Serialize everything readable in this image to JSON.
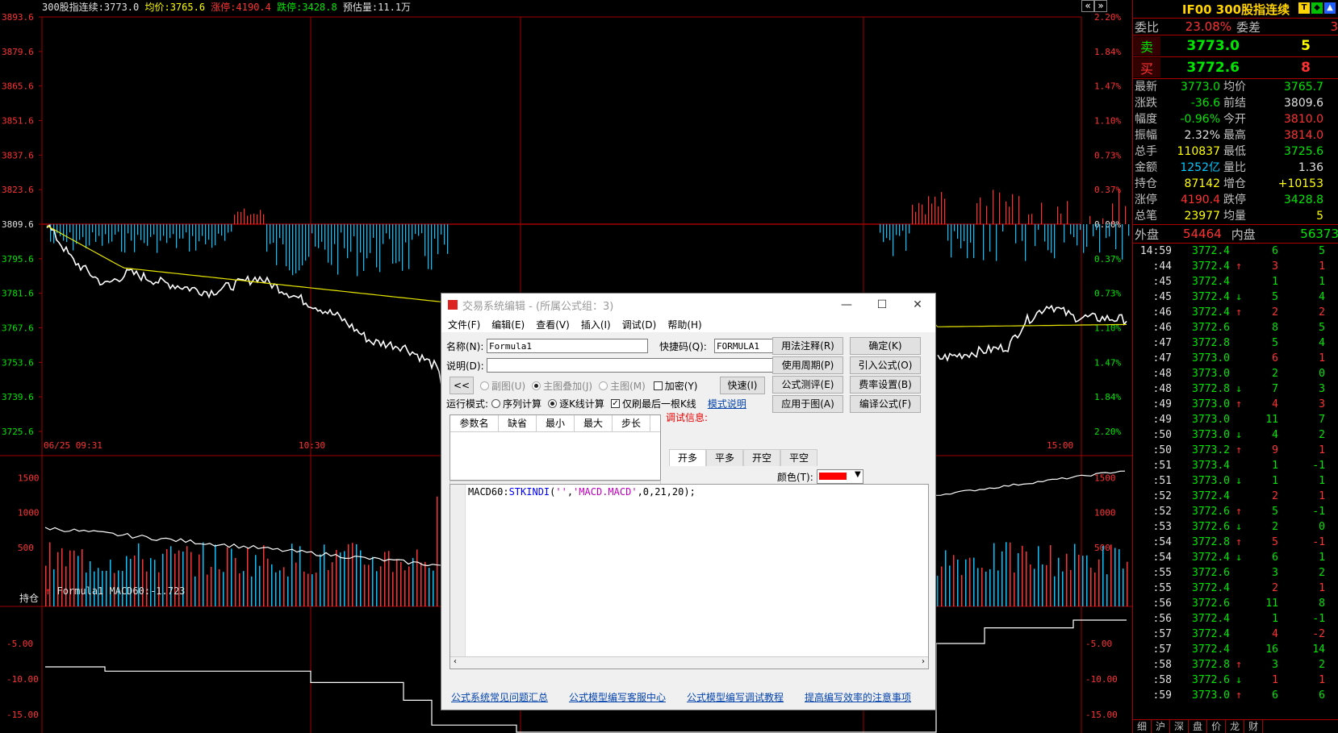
{
  "top_info": {
    "name": "300股指连续:3773.0",
    "avg": "均价:3765.6",
    "limit_up": "涨停:4190.4",
    "limit_down": "跌停:3428.8",
    "est_volume": "预估量:11.1万"
  },
  "price_axis_left": [
    "3893.6",
    "3879.6",
    "3865.6",
    "3851.6",
    "3837.6",
    "3823.6",
    "3809.6",
    "3795.6",
    "3781.6",
    "3767.6",
    "3753.6",
    "3739.6",
    "3725.6"
  ],
  "price_axis_right": [
    "2.20%",
    "1.84%",
    "1.47%",
    "1.10%",
    "0.73%",
    "0.37%",
    "0.00%",
    "0.37%",
    "0.73%",
    "1.10%",
    "1.47%",
    "1.84%",
    "2.20%"
  ],
  "time_axis": [
    "06/25 09:31",
    "10:30",
    "15:00"
  ],
  "volume_axis": [
    "1500",
    "1000",
    "500"
  ],
  "volume_label": "持仓",
  "macd": {
    "title": "Formula1 MACD60:-1.723",
    "axis": [
      "-5.00",
      "-10.00",
      "-15.00"
    ]
  },
  "colors": {
    "up": "#ff3232",
    "down": "#00c8ff",
    "price": "#ffffff",
    "avg": "#e6e600",
    "grid": "#a00000",
    "bg": "#000000"
  },
  "right_panel": {
    "title": "IF00 300股指连续",
    "toolbar_icons": [
      "T",
      "green-icon",
      "up-icon"
    ],
    "commission_ratio_label": "委比",
    "commission_ratio": "23.08%",
    "commission_diff_label": "委差",
    "commission_diff": "3",
    "sell_label": "卖",
    "sell_price": "3773.0",
    "sell_vol": "5",
    "buy_label": "买",
    "buy_price": "3772.6",
    "buy_vol": "8",
    "quote": [
      [
        "最新",
        "3773.0",
        "均价",
        "3765.7"
      ],
      [
        "涨跌",
        "-36.6",
        "前结",
        "3809.6"
      ],
      [
        "幅度",
        "-0.96%",
        "今开",
        "3810.0"
      ],
      [
        "振幅",
        "2.32%",
        "最高",
        "3814.0"
      ],
      [
        "总手",
        "110837",
        "最低",
        "3725.6"
      ],
      [
        "金额",
        "1252亿",
        "量比",
        "1.36"
      ],
      [
        "持仓",
        "87142",
        "增仓",
        "+10153"
      ],
      [
        "涨停",
        "4190.4",
        "跌停",
        "3428.8"
      ],
      [
        "总笔",
        "23977",
        "均量",
        "5"
      ]
    ],
    "outer_label": "外盘",
    "outer": "54464",
    "inner_label": "内盘",
    "inner": "56373",
    "ticks": [
      [
        "14:59",
        "3772.4",
        "",
        "6",
        "5"
      ],
      [
        ":44",
        "3772.4",
        "↑",
        "3",
        "1"
      ],
      [
        ":45",
        "3772.4",
        "",
        "1",
        "1"
      ],
      [
        ":45",
        "3772.4",
        "↓",
        "5",
        "4"
      ],
      [
        ":46",
        "3772.4",
        "↑",
        "2",
        "2"
      ],
      [
        ":46",
        "3772.6",
        "",
        "8",
        "5"
      ],
      [
        ":47",
        "3772.8",
        "",
        "5",
        "4"
      ],
      [
        ":47",
        "3773.0",
        "",
        "6",
        "1"
      ],
      [
        ":48",
        "3773.0",
        "",
        "2",
        "0"
      ],
      [
        ":48",
        "3772.8",
        "↓",
        "7",
        "3"
      ],
      [
        ":49",
        "3773.0",
        "↑",
        "4",
        "3"
      ],
      [
        ":49",
        "3773.0",
        "",
        "11",
        "7"
      ],
      [
        ":50",
        "3773.0",
        "↓",
        "4",
        "2"
      ],
      [
        ":50",
        "3773.2",
        "↑",
        "9",
        "1"
      ],
      [
        ":51",
        "3773.4",
        "",
        "1",
        "-1"
      ],
      [
        ":51",
        "3773.0",
        "↓",
        "1",
        "1"
      ],
      [
        ":52",
        "3772.4",
        "",
        "2",
        "1"
      ],
      [
        ":52",
        "3772.6",
        "↑",
        "5",
        "-1"
      ],
      [
        ":53",
        "3772.6",
        "↓",
        "2",
        "0"
      ],
      [
        ":54",
        "3772.8",
        "↑",
        "5",
        "-1"
      ],
      [
        ":54",
        "3772.4",
        "↓",
        "6",
        "1"
      ],
      [
        ":55",
        "3772.6",
        "",
        "3",
        "2"
      ],
      [
        ":55",
        "3772.4",
        "",
        "2",
        "1"
      ],
      [
        ":56",
        "3772.6",
        "",
        "11",
        "8"
      ],
      [
        ":56",
        "3772.4",
        "",
        "1",
        "-1"
      ],
      [
        ":57",
        "3772.4",
        "",
        "4",
        "-2"
      ],
      [
        ":57",
        "3772.4",
        "",
        "16",
        "14"
      ],
      [
        ":58",
        "3772.8",
        "↑",
        "3",
        "2"
      ],
      [
        ":58",
        "3772.6",
        "↓",
        "1",
        "1"
      ],
      [
        ":59",
        "3773.0",
        "↑",
        "6",
        "6"
      ]
    ],
    "bottom_tabs": [
      "细",
      "沪",
      "深",
      "盘",
      "价",
      "龙",
      "财"
    ]
  },
  "dialog": {
    "title": "交易系统编辑 - (所属公式组：3)",
    "menu": [
      "文件(F)",
      "编辑(E)",
      "查看(V)",
      "插入(I)",
      "调试(D)",
      "帮助(H)"
    ],
    "name_label": "名称(N):",
    "name_value": "Formula1",
    "shortcut_label": "快捷码(Q):",
    "shortcut_value": "FORMULA1",
    "desc_label": "说明(D):",
    "desc_value": "",
    "btn_usage_note": "用法注释(R)",
    "btn_ok": "确定(K)",
    "btn_period": "使用周期(P)",
    "btn_import": "引入公式(O)",
    "btn_test": "公式测评(E)",
    "btn_fee": "费率设置(B)",
    "btn_apply": "应用于图(A)",
    "btn_compile": "编译公式(F)",
    "btn_back": "<<",
    "radio_sub": "副图(U)",
    "radio_overlay": "主图叠加(J)",
    "radio_main": "主图(M)",
    "check_encrypt": "加密(Y)",
    "btn_fast": "快速(I)",
    "run_mode_label": "运行模式:",
    "run_seq": "序列计算",
    "run_tick": "逐K线计算",
    "run_last": "仅刷最后一根K线",
    "mode_link": "模式说明",
    "param_headers": [
      "参数名",
      "缺省",
      "最小",
      "最大",
      "步长"
    ],
    "debug_label": "调试信息:",
    "tabs": [
      "开多",
      "平多",
      "开空",
      "平空"
    ],
    "color_label": "颜色(T):",
    "code_parts": [
      "MACD60:",
      "STKINDI",
      "(",
      "''",
      ",",
      "'MACD.MACD'",
      ",0,21,20);"
    ],
    "footer_links": [
      "公式系统常见问题汇总",
      "公式模型编写客服中心",
      "公式模型编写调试教程",
      "提高编写效率的注意事项"
    ]
  }
}
